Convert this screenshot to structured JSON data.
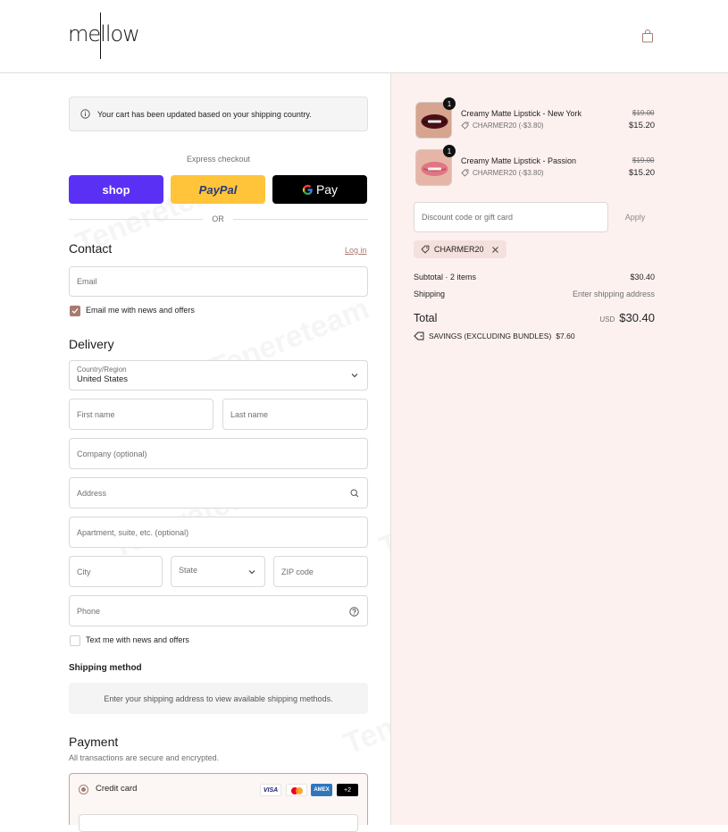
{
  "brand": {
    "logo_text": "mellow"
  },
  "watermark": {
    "text": "Tenereteam"
  },
  "notice": {
    "text": "Your cart has been updated based on your shipping country."
  },
  "express": {
    "label": "Express checkout",
    "shop": "shop",
    "paypal": "PayPal",
    "gpay": "Pay",
    "divider": "OR"
  },
  "contact": {
    "title": "Contact",
    "login": "Log in",
    "email_placeholder": "Email",
    "news_label": "Email me with news and offers",
    "news_checked": true
  },
  "delivery": {
    "title": "Delivery",
    "country_label": "Country/Region",
    "country_value": "United States",
    "first_name": "First name",
    "last_name": "Last name",
    "company": "Company (optional)",
    "address": "Address",
    "apartment": "Apartment, suite, etc. (optional)",
    "city": "City",
    "state": "State",
    "zip": "ZIP code",
    "phone": "Phone",
    "sms_label": "Text me with news and offers"
  },
  "shipping_method": {
    "title": "Shipping method",
    "message": "Enter your shipping address to view available shipping methods."
  },
  "payment": {
    "title": "Payment",
    "subtitle": "All transactions are secure and encrypted.",
    "method": "Credit card",
    "cards": [
      "VISA",
      "",
      "AMEX",
      "+2"
    ]
  },
  "order": {
    "items": [
      {
        "name": "Creamy Matte Lipstick - New York",
        "discount": "CHARMER20 (-$3.80)",
        "original": "$19.00",
        "price": "$15.20",
        "qty": "1",
        "lip_color": "#4a0f16"
      },
      {
        "name": "Creamy Matte Lipstick - Passion",
        "discount": "CHARMER20 (-$3.80)",
        "original": "$19.00",
        "price": "$15.20",
        "qty": "1",
        "lip_color": "#e07583"
      }
    ],
    "discount_placeholder": "Discount code or gift card",
    "apply": "Apply",
    "code_tag": "CHARMER20",
    "subtotal_label": "Subtotal · 2 items",
    "subtotal_value": "$30.40",
    "shipping_label": "Shipping",
    "shipping_value": "Enter shipping address",
    "total_label": "Total",
    "currency": "USD",
    "total_value": "$30.40",
    "savings_label": "SAVINGS (EXCLUDING BUNDLES)",
    "savings_value": "$7.60"
  },
  "colors": {
    "accent": "#a87b6f",
    "shop": "#5a31f4",
    "paypal": "#ffc439",
    "right_bg": "#fdf1f0"
  }
}
